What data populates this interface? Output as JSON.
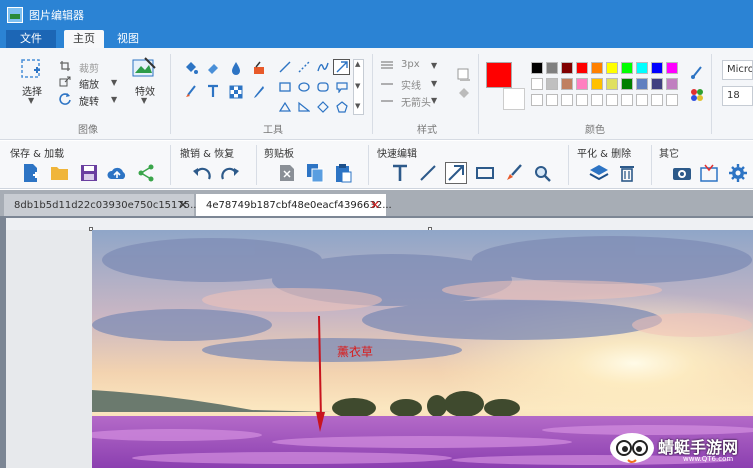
{
  "app": {
    "title": "图片编辑器"
  },
  "menu": {
    "file": "文件",
    "home": "主页",
    "view": "视图"
  },
  "ribbon": {
    "select_label": "选择",
    "crop_label": "裁剪",
    "resize_label": "缩放",
    "rotate_label": "旋转",
    "effects_label": "特效",
    "group_image": "图像",
    "group_tools": "工具",
    "stroke_width": "3px",
    "line_style": "实线",
    "arrow_style": "无箭头",
    "group_style": "样式",
    "group_color": "颜色",
    "font_name": "Micro",
    "font_size": "18",
    "primary_color": "#ff0000",
    "palette": [
      "#000000",
      "#808080",
      "#800000",
      "#ff0000",
      "#ff8000",
      "#ffff00",
      "#00ff00",
      "#00ffff",
      "#0000ff",
      "#ff00ff",
      "#ffffff",
      "#c0c0c0",
      "#c08060",
      "#ff80c0",
      "#ffc000",
      "#e0e060",
      "#008000",
      "#6080c0",
      "#404080",
      "#c080c0"
    ]
  },
  "toolbar": {
    "save_load": "保存 & 加载",
    "undo_redo": "撤销 & 恢复",
    "clipboard": "剪贴板",
    "quick_edit": "快速编辑",
    "flatten_delete": "平化 & 删除",
    "other": "其它"
  },
  "tabs": [
    {
      "label": "8db1b5d11d22c03930e750c15175..."
    },
    {
      "label": "4e78749b187cbf48e0eacf4396632..."
    }
  ],
  "canvas": {
    "annotation": "薰衣草",
    "annotation_color": "#d81e1e"
  },
  "watermark": {
    "name": "蜻蜓手游网",
    "url": "www.QT6.com"
  }
}
